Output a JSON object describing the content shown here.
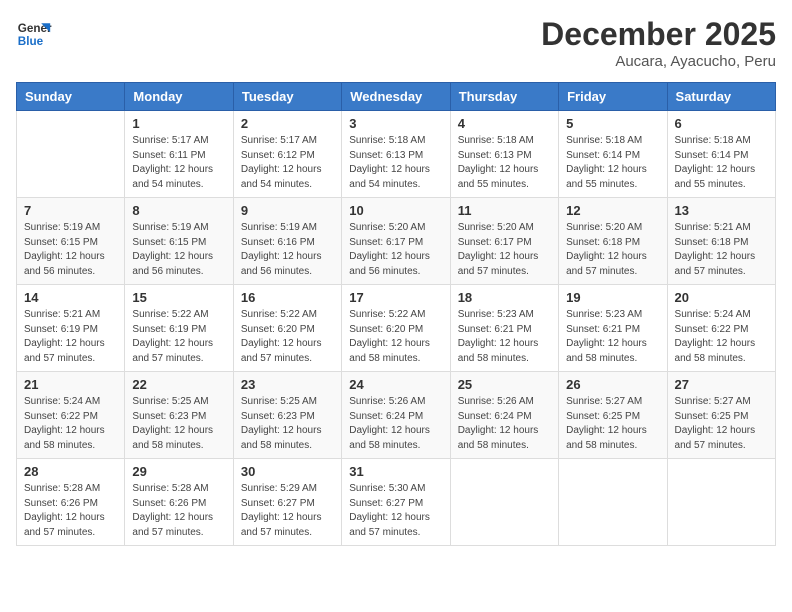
{
  "logo": {
    "line1": "General",
    "line2": "Blue"
  },
  "title": "December 2025",
  "subtitle": "Aucara, Ayacucho, Peru",
  "days_of_week": [
    "Sunday",
    "Monday",
    "Tuesday",
    "Wednesday",
    "Thursday",
    "Friday",
    "Saturday"
  ],
  "weeks": [
    [
      {
        "num": "",
        "info": ""
      },
      {
        "num": "1",
        "info": "Sunrise: 5:17 AM\nSunset: 6:11 PM\nDaylight: 12 hours\nand 54 minutes."
      },
      {
        "num": "2",
        "info": "Sunrise: 5:17 AM\nSunset: 6:12 PM\nDaylight: 12 hours\nand 54 minutes."
      },
      {
        "num": "3",
        "info": "Sunrise: 5:18 AM\nSunset: 6:13 PM\nDaylight: 12 hours\nand 54 minutes."
      },
      {
        "num": "4",
        "info": "Sunrise: 5:18 AM\nSunset: 6:13 PM\nDaylight: 12 hours\nand 55 minutes."
      },
      {
        "num": "5",
        "info": "Sunrise: 5:18 AM\nSunset: 6:14 PM\nDaylight: 12 hours\nand 55 minutes."
      },
      {
        "num": "6",
        "info": "Sunrise: 5:18 AM\nSunset: 6:14 PM\nDaylight: 12 hours\nand 55 minutes."
      }
    ],
    [
      {
        "num": "7",
        "info": "Sunrise: 5:19 AM\nSunset: 6:15 PM\nDaylight: 12 hours\nand 56 minutes."
      },
      {
        "num": "8",
        "info": "Sunrise: 5:19 AM\nSunset: 6:15 PM\nDaylight: 12 hours\nand 56 minutes."
      },
      {
        "num": "9",
        "info": "Sunrise: 5:19 AM\nSunset: 6:16 PM\nDaylight: 12 hours\nand 56 minutes."
      },
      {
        "num": "10",
        "info": "Sunrise: 5:20 AM\nSunset: 6:17 PM\nDaylight: 12 hours\nand 56 minutes."
      },
      {
        "num": "11",
        "info": "Sunrise: 5:20 AM\nSunset: 6:17 PM\nDaylight: 12 hours\nand 57 minutes."
      },
      {
        "num": "12",
        "info": "Sunrise: 5:20 AM\nSunset: 6:18 PM\nDaylight: 12 hours\nand 57 minutes."
      },
      {
        "num": "13",
        "info": "Sunrise: 5:21 AM\nSunset: 6:18 PM\nDaylight: 12 hours\nand 57 minutes."
      }
    ],
    [
      {
        "num": "14",
        "info": "Sunrise: 5:21 AM\nSunset: 6:19 PM\nDaylight: 12 hours\nand 57 minutes."
      },
      {
        "num": "15",
        "info": "Sunrise: 5:22 AM\nSunset: 6:19 PM\nDaylight: 12 hours\nand 57 minutes."
      },
      {
        "num": "16",
        "info": "Sunrise: 5:22 AM\nSunset: 6:20 PM\nDaylight: 12 hours\nand 57 minutes."
      },
      {
        "num": "17",
        "info": "Sunrise: 5:22 AM\nSunset: 6:20 PM\nDaylight: 12 hours\nand 58 minutes."
      },
      {
        "num": "18",
        "info": "Sunrise: 5:23 AM\nSunset: 6:21 PM\nDaylight: 12 hours\nand 58 minutes."
      },
      {
        "num": "19",
        "info": "Sunrise: 5:23 AM\nSunset: 6:21 PM\nDaylight: 12 hours\nand 58 minutes."
      },
      {
        "num": "20",
        "info": "Sunrise: 5:24 AM\nSunset: 6:22 PM\nDaylight: 12 hours\nand 58 minutes."
      }
    ],
    [
      {
        "num": "21",
        "info": "Sunrise: 5:24 AM\nSunset: 6:22 PM\nDaylight: 12 hours\nand 58 minutes."
      },
      {
        "num": "22",
        "info": "Sunrise: 5:25 AM\nSunset: 6:23 PM\nDaylight: 12 hours\nand 58 minutes."
      },
      {
        "num": "23",
        "info": "Sunrise: 5:25 AM\nSunset: 6:23 PM\nDaylight: 12 hours\nand 58 minutes."
      },
      {
        "num": "24",
        "info": "Sunrise: 5:26 AM\nSunset: 6:24 PM\nDaylight: 12 hours\nand 58 minutes."
      },
      {
        "num": "25",
        "info": "Sunrise: 5:26 AM\nSunset: 6:24 PM\nDaylight: 12 hours\nand 58 minutes."
      },
      {
        "num": "26",
        "info": "Sunrise: 5:27 AM\nSunset: 6:25 PM\nDaylight: 12 hours\nand 58 minutes."
      },
      {
        "num": "27",
        "info": "Sunrise: 5:27 AM\nSunset: 6:25 PM\nDaylight: 12 hours\nand 57 minutes."
      }
    ],
    [
      {
        "num": "28",
        "info": "Sunrise: 5:28 AM\nSunset: 6:26 PM\nDaylight: 12 hours\nand 57 minutes."
      },
      {
        "num": "29",
        "info": "Sunrise: 5:28 AM\nSunset: 6:26 PM\nDaylight: 12 hours\nand 57 minutes."
      },
      {
        "num": "30",
        "info": "Sunrise: 5:29 AM\nSunset: 6:27 PM\nDaylight: 12 hours\nand 57 minutes."
      },
      {
        "num": "31",
        "info": "Sunrise: 5:30 AM\nSunset: 6:27 PM\nDaylight: 12 hours\nand 57 minutes."
      },
      {
        "num": "",
        "info": ""
      },
      {
        "num": "",
        "info": ""
      },
      {
        "num": "",
        "info": ""
      }
    ]
  ]
}
